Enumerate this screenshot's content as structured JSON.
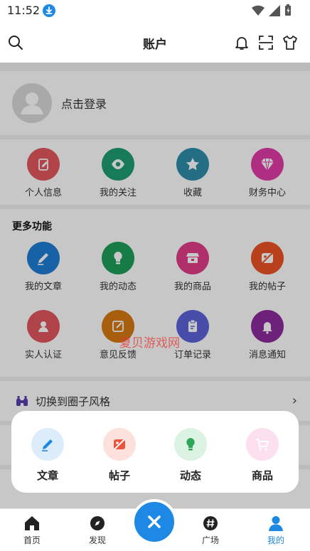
{
  "status_bar": {
    "time": "11:52"
  },
  "header": {
    "title": "账户"
  },
  "login": {
    "text": "点击登录"
  },
  "quick_links": [
    {
      "label": "个人信息",
      "icon": "edit-doc-icon",
      "color": "#e2585e"
    },
    {
      "label": "我的关注",
      "icon": "eye-icon",
      "color": "#1e9e72"
    },
    {
      "label": "收藏",
      "icon": "star-icon",
      "color": "#2d8eab"
    },
    {
      "label": "财务中心",
      "icon": "diamond-icon",
      "color": "#e03ca7"
    }
  ],
  "more": {
    "title": "更多功能",
    "items": [
      {
        "label": "我的文章",
        "icon": "pencil-icon",
        "color": "#1e7dd6"
      },
      {
        "label": "我的动态",
        "icon": "bulb-icon",
        "color": "#1e9e59"
      },
      {
        "label": "我的商品",
        "icon": "shop-icon",
        "color": "#e23c88"
      },
      {
        "label": "我的帖子",
        "icon": "no-image-icon",
        "color": "#ec5324"
      },
      {
        "label": "实人认证",
        "icon": "id-person-icon",
        "color": "#e2565e"
      },
      {
        "label": "意见反馈",
        "icon": "feedback-icon",
        "color": "#d77a12"
      },
      {
        "label": "订单记录",
        "icon": "clipboard-icon",
        "color": "#5b63d9"
      },
      {
        "label": "消息通知",
        "icon": "bell-icon",
        "color": "#8c2b9e"
      }
    ]
  },
  "switch_style": {
    "label": "切换到圈子风格"
  },
  "popup": {
    "items": [
      {
        "label": "文章",
        "icon": "pencil-icon",
        "color": "#1e88e5",
        "bg": "#dcecfb"
      },
      {
        "label": "帖子",
        "icon": "no-image-icon",
        "color": "#e9563d",
        "bg": "#fbe0db"
      },
      {
        "label": "动态",
        "icon": "bulb-icon",
        "color": "#2ea65a",
        "bg": "#dcf2e3"
      },
      {
        "label": "商品",
        "icon": "cart-icon",
        "color": "#e62e94",
        "bg": "#fde0ef"
      }
    ]
  },
  "watermark": "夏贝游戏网",
  "bottom_nav": [
    {
      "label": "首页",
      "icon": "home-icon"
    },
    {
      "label": "发现",
      "icon": "compass-icon"
    },
    {
      "label": "广场",
      "icon": "hashtag-icon"
    },
    {
      "label": "我的",
      "icon": "user-icon",
      "active": true
    }
  ],
  "colors": {
    "accent": "#1e88e5"
  }
}
